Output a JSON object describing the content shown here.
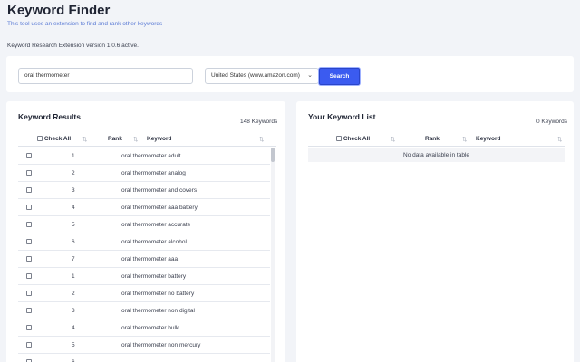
{
  "header": {
    "title": "Keyword Finder",
    "subtitle": "This tool uses an extension to find and rank other keywords",
    "status": "Keyword Research Extension version 1.0.6 active."
  },
  "search": {
    "value": "oral thermometer",
    "country": "United States (www.amazon.com)",
    "button_label": "Search"
  },
  "results": {
    "title": "Keyword Results",
    "count": "148 Keywords",
    "columns": {
      "check_all": "Check All",
      "rank": "Rank",
      "keyword": "Keyword",
      "sort_icon": "⇅"
    },
    "rows": [
      {
        "rank": "1",
        "keyword": "oral thermometer adult"
      },
      {
        "rank": "2",
        "keyword": "oral thermometer analog"
      },
      {
        "rank": "3",
        "keyword": "oral thermometer and covers"
      },
      {
        "rank": "4",
        "keyword": "oral thermometer aaa battery"
      },
      {
        "rank": "5",
        "keyword": "oral thermometer accurate"
      },
      {
        "rank": "6",
        "keyword": "oral thermometer alcohol"
      },
      {
        "rank": "7",
        "keyword": "oral thermometer aaa"
      },
      {
        "rank": "1",
        "keyword": "oral thermometer battery"
      },
      {
        "rank": "2",
        "keyword": "oral thermometer no battery"
      },
      {
        "rank": "3",
        "keyword": "oral thermometer non digital"
      },
      {
        "rank": "4",
        "keyword": "oral thermometer bulk"
      },
      {
        "rank": "5",
        "keyword": "oral thermometer non mercury"
      },
      {
        "rank": "6",
        "keyword": ""
      }
    ]
  },
  "your_list": {
    "title": "Your Keyword List",
    "count": "0 Keywords",
    "columns": {
      "check_all": "Check All",
      "rank": "Rank",
      "keyword": "Keyword",
      "sort_icon": "⇅"
    },
    "empty_text": "No data available in table"
  }
}
